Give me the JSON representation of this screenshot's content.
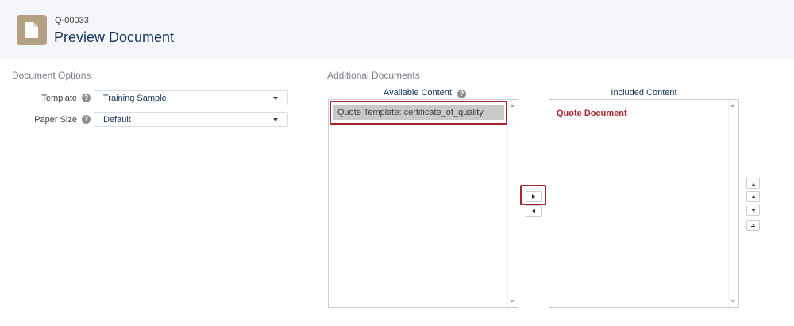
{
  "header": {
    "record_number": "Q-00033",
    "title": "Preview Document",
    "icon": "document-icon"
  },
  "document_options": {
    "section_title": "Document Options",
    "template": {
      "label": "Template",
      "value": "Training Sample"
    },
    "paper_size": {
      "label": "Paper Size",
      "value": "Default"
    }
  },
  "additional_documents": {
    "section_title": "Additional Documents",
    "available": {
      "header": "Available Content",
      "items": [
        "Quote Template: certificate_of_quality"
      ]
    },
    "included": {
      "header": "Included Content",
      "items": [
        "Quote Document"
      ]
    }
  },
  "colors": {
    "highlight": "#a4272d",
    "header_bg": "#f4f6f9",
    "badge": "#b4a184"
  }
}
